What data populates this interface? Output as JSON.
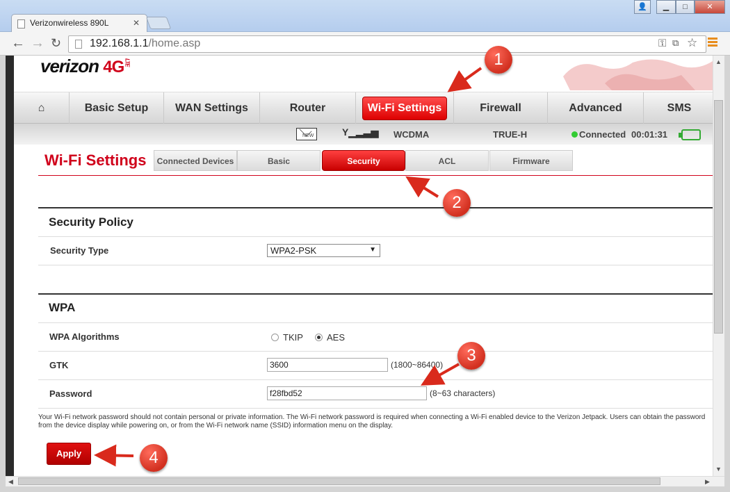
{
  "browser": {
    "tab_title": "Verizonwireless 890L",
    "url_host": "192.168.1.1",
    "url_path": "/home.asp"
  },
  "brand": {
    "name": "verizon",
    "g": "4G",
    "lte": "LTE"
  },
  "main_nav": [
    "Basic Setup",
    "WAN Settings",
    "Router",
    "Wi-Fi Settings",
    "Firewall",
    "Advanced",
    "SMS"
  ],
  "status": {
    "network": "WCDMA",
    "carrier": "TRUE-H",
    "connection": "Connected",
    "timer": "00:01:31",
    "new_badge": "NEW"
  },
  "page_title": "Wi-Fi Settings",
  "sub_tabs": [
    "Connected Devices",
    "Basic",
    "Security",
    "ACL",
    "Firmware"
  ],
  "security_policy": {
    "heading": "Security Policy",
    "type_label": "Security Type",
    "type_value": "WPA2-PSK"
  },
  "wpa": {
    "heading": "WPA",
    "alg_label": "WPA Algorithms",
    "alg_options": [
      "TKIP",
      "AES"
    ],
    "alg_selected": "AES",
    "gtk_label": "GTK",
    "gtk_value": "3600",
    "gtk_hint": "(1800~86400)",
    "pw_label": "Password",
    "pw_value": "f28fbd52",
    "pw_hint": "(8~63 characters)"
  },
  "description": "Your Wi-Fi network password should not contain personal or private information. The Wi-Fi network password is required when connecting a Wi-Fi enabled device to the Verizon Jetpack. Users can obtain the password from the device display while powering on, or from the Wi-Fi network name (SSID) information menu on the display.",
  "apply_label": "Apply",
  "annotations": [
    "1",
    "2",
    "3",
    "4"
  ],
  "colors": {
    "accent": "#d0021b",
    "annotation": "#d23020"
  }
}
